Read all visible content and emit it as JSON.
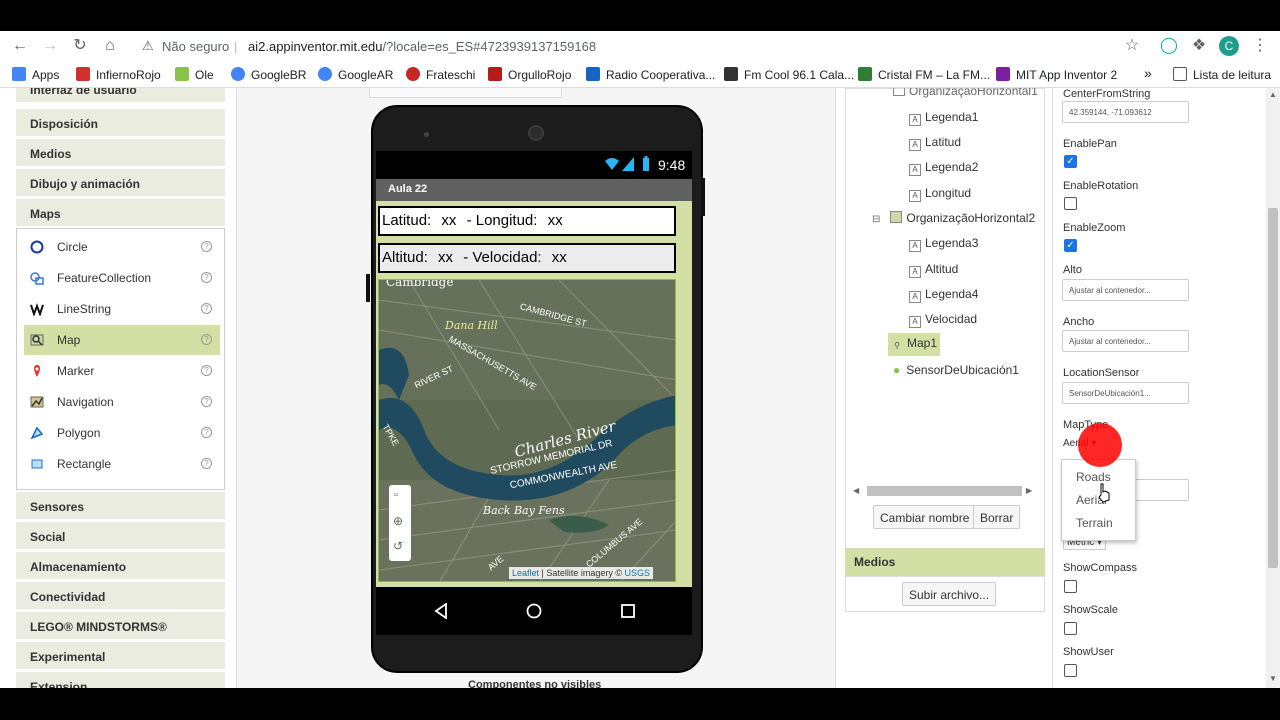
{
  "browser": {
    "security_label": "Não seguro",
    "url_host": "ai2.appinventor.mit.edu",
    "url_path": "/?locale=es_ES#4723939137159168",
    "profile_initial": "C"
  },
  "bookmarks": [
    {
      "label": "Apps",
      "color": "#4285f4"
    },
    {
      "label": "InfiernoRojo",
      "color": "#d32f2f"
    },
    {
      "label": "Ole",
      "color": "#8bc34a"
    },
    {
      "label": "GoogleBR",
      "color": "#4285f4"
    },
    {
      "label": "GoogleAR",
      "color": "#4285f4"
    },
    {
      "label": "Frateschi",
      "color": "#c62828"
    },
    {
      "label": "OrgulloRojo",
      "color": "#b71c1c"
    },
    {
      "label": "Radio Cooperativa...",
      "color": "#1565c0"
    },
    {
      "label": "Fm Cool 96.1 Cala...",
      "color": "#333333"
    },
    {
      "label": "Cristal FM – La FM...",
      "color": "#2e7d32"
    },
    {
      "label": "MIT App Inventor 2",
      "color": "#7b1fa2"
    }
  ],
  "bookmarks_more": "»",
  "reading_list": "Lista de leitura",
  "palette": {
    "top_cut": "Interfaz de usuario",
    "categories_top": [
      "Disposición",
      "Medios",
      "Dibujo y animación",
      "Maps"
    ],
    "maps_items": [
      {
        "label": "Circle",
        "icon": "circle-icon"
      },
      {
        "label": "FeatureCollection",
        "icon": "feature-collection-icon"
      },
      {
        "label": "LineString",
        "icon": "linestring-icon"
      },
      {
        "label": "Map",
        "icon": "map-icon",
        "selected": true
      },
      {
        "label": "Marker",
        "icon": "marker-icon"
      },
      {
        "label": "Navigation",
        "icon": "navigation-icon"
      },
      {
        "label": "Polygon",
        "icon": "polygon-icon"
      },
      {
        "label": "Rectangle",
        "icon": "rectangle-icon"
      }
    ],
    "help_glyph": "?",
    "categories_bottom": [
      "Sensores",
      "Social",
      "Almacenamiento",
      "Conectividad",
      "LEGO® MINDSTORMS®",
      "Experimental",
      "Extension"
    ]
  },
  "phone": {
    "time": "9:48",
    "screen_title": "Aula 22",
    "row1": {
      "l1": "Latitud:",
      "v1": "xx",
      "l2": "- Longitud:",
      "v2": "xx"
    },
    "row2": {
      "l1": "Altitud:",
      "v1": "xx",
      "l2": "- Velocidad:",
      "v2": "xx"
    },
    "map_labels": {
      "cambridge": "Cambridge",
      "dana": "Dana Hill",
      "cambridge_st": "CAMBRIDGE ST",
      "mass_ave": "MASSACHUSETTS AVE",
      "river_st": "RIVER ST",
      "charles": "Charles River",
      "storrow": "STORROW MEMORIAL DR",
      "commonwealth": "COMMONWEALTH AVE",
      "backbay": "Back Bay Fens",
      "columbus": "COLUMBUS AVE",
      "pike": "TPKE",
      "ave": "AVE"
    },
    "attribution_leaflet": "Leaflet",
    "attribution_mid": " | Satellite imagery © ",
    "attribution_usgs": "USGS",
    "nonvisible": "Componentes no visibles"
  },
  "tree": {
    "top_cut": "OrganizaçãoHorizontal1",
    "nodes1": [
      "Legenda1",
      "Latitud",
      "Legenda2",
      "Longitud"
    ],
    "org2": "OrganizaçãoHorizontal2",
    "nodes2": [
      "Legenda3",
      "Altitud",
      "Legenda4",
      "Velocidad"
    ],
    "map1": "Map1",
    "sensor": "SensorDeUbicación1",
    "rename": "Cambiar nombre",
    "delete": "Borrar",
    "media_header": "Medios",
    "upload": "Subir archivo..."
  },
  "props": {
    "center_label": "CenterFromString",
    "center_value": "42.359144, -71.093612",
    "enable_pan": "EnablePan",
    "enable_rotation": "EnableRotation",
    "enable_zoom": "EnableZoom",
    "alto": "Alto",
    "alto_value": "Ajustar al contenedor...",
    "ancho": "Ancho",
    "ancho_value": "Ajustar al contenedor...",
    "location_sensor": "LocationSensor",
    "location_value": "SensorDeUbicación1...",
    "map_type": "MapType",
    "map_type_value": "Aerial",
    "options": [
      "Roads",
      "Aerial",
      "Terrain"
    ],
    "scale_units": "Metric",
    "show_compass": "ShowCompass",
    "show_scale": "ShowScale",
    "show_user": "ShowUser"
  }
}
